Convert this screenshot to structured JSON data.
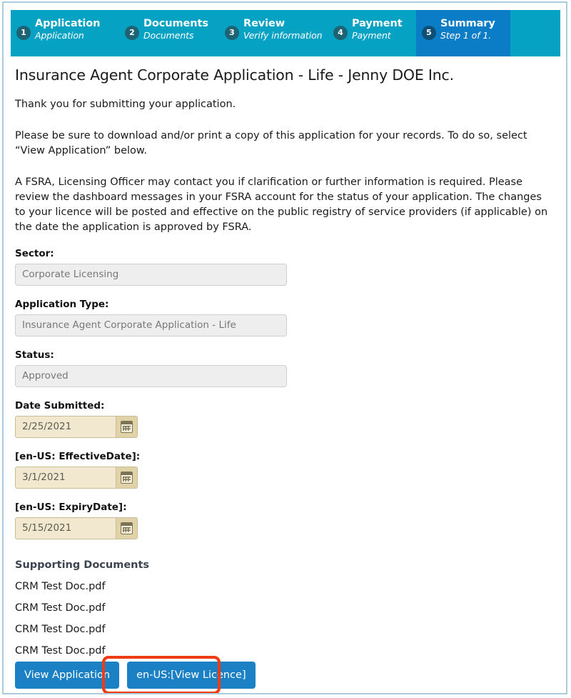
{
  "theme": {
    "stepper_bg": "#06a2c3",
    "stepper_active_bg": "#0b7dc6",
    "circle_bg": "#1e6374",
    "button_blue": "#1b81c4",
    "annotation_red": "#ef3b11",
    "date_field_bg": "#f2e8cf",
    "input_bg": "#eeeeee",
    "frame_border": "#a9cddd"
  },
  "stepper": {
    "steps": [
      {
        "number": "1",
        "title": "Application",
        "subtitle": "Application",
        "active": false
      },
      {
        "number": "2",
        "title": "Documents",
        "subtitle": "Documents",
        "active": false
      },
      {
        "number": "3",
        "title": "Review",
        "subtitle": "Verify information",
        "active": false
      },
      {
        "number": "4",
        "title": "Payment",
        "subtitle": "Payment",
        "active": false
      },
      {
        "number": "5",
        "title": "Summary",
        "subtitle": "Step 1 of 1.",
        "active": true
      }
    ]
  },
  "main": {
    "title": "Insurance Agent Corporate Application - Life - Jenny DOE Inc.",
    "thanks": "Thank you for submitting your application.",
    "para_download": "Please be sure to download and/or print a copy of this application for your records. To do so, select “View Application” below.",
    "para_fsra": "A FSRA, Licensing Officer may contact you if clarification or further information is required. Please review the dashboard messages in your FSRA account for the status of your application. The changes to your licence will be posted and effective on the public registry of service providers (if applicable) on the date the application is approved by FSRA."
  },
  "fields": {
    "sector": {
      "label": "Sector:",
      "value": "Corporate Licensing"
    },
    "application_type": {
      "label": "Application Type:",
      "value": "Insurance Agent Corporate Application - Life"
    },
    "status": {
      "label": "Status:",
      "value": "Approved"
    },
    "date_submitted": {
      "label": "Date Submitted:",
      "value": "2/25/2021",
      "icon": "calendar-icon"
    },
    "effective_date": {
      "label": "[en-US: EffectiveDate]:",
      "value": "3/1/2021",
      "icon": "calendar-icon"
    },
    "expiry_date": {
      "label": "[en-US: ExpiryDate]:",
      "value": "5/15/2021",
      "icon": "calendar-icon"
    }
  },
  "documents": {
    "heading": "Supporting Documents",
    "items": [
      "CRM Test Doc.pdf",
      "CRM Test Doc.pdf",
      "CRM Test Doc.pdf",
      "CRM Test Doc.pdf"
    ]
  },
  "actions": {
    "view_application": "View Application",
    "view_licence": "en-US:[View Licence]"
  }
}
